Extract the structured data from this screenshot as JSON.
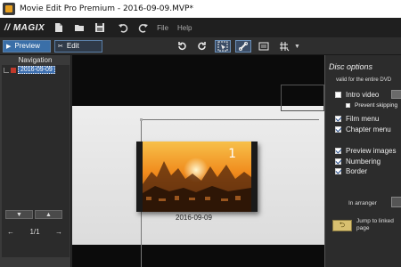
{
  "window": {
    "title": "Movie Edit Pro Premium - 2016-09-09.MVP*"
  },
  "menubar": {
    "logo": "// MAGIX",
    "menus": [
      "File",
      "Help"
    ]
  },
  "toolbar": {
    "tabs": [
      {
        "label": "Preview",
        "active": true
      },
      {
        "label": "Edit",
        "active": false
      }
    ]
  },
  "navigation": {
    "title": "Navigation",
    "items": [
      {
        "label": "2016-09-09"
      }
    ],
    "pager": "1/1"
  },
  "preview": {
    "thumb_number": "1",
    "thumb_caption": "2016-09-09"
  },
  "disc_options": {
    "title": "Disc options",
    "subtitle": "valid for the entire DVD",
    "intro_video": {
      "label": "Intro video",
      "checked": false
    },
    "prevent_skipping": {
      "label": "Prevent skipping",
      "checked": false
    },
    "film_menu": {
      "label": "Film menu",
      "checked": true
    },
    "chapter_menu": {
      "label": "Chapter menu",
      "checked": true
    },
    "preview_images": {
      "label": "Preview images",
      "checked": true
    },
    "numbering": {
      "label": "Numbering",
      "checked": true
    },
    "border": {
      "label": "Border",
      "checked": true
    },
    "in_arranger": "In arranger",
    "jump_label": "Jump to linked page"
  },
  "colors": {
    "accent": "#3a6fa8",
    "selection": "#3d6fb0",
    "panel_bg": "#2c2c2c"
  }
}
